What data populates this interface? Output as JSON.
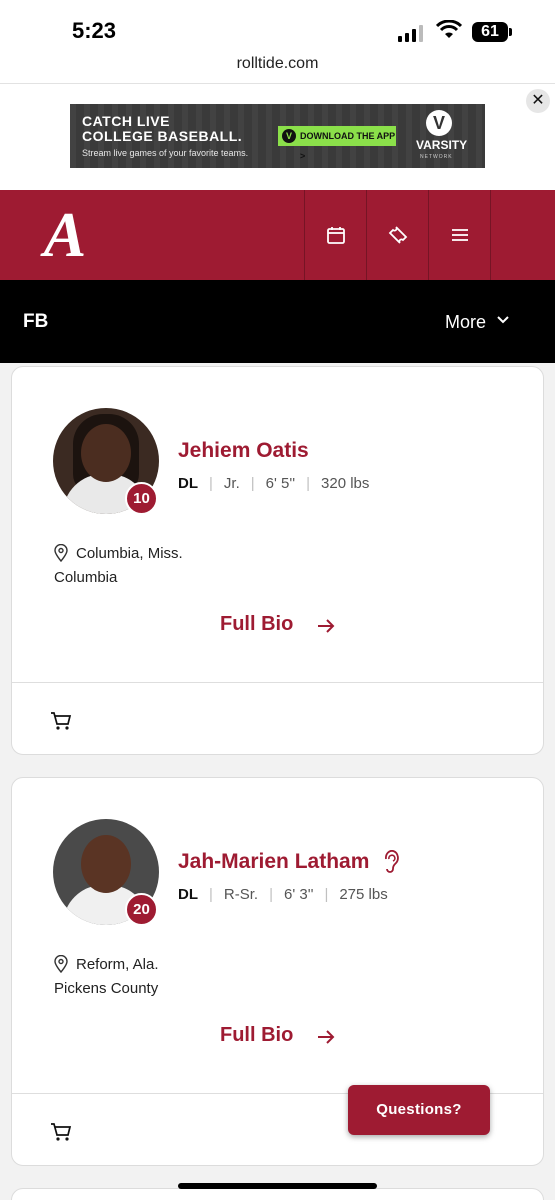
{
  "status_bar": {
    "time": "5:23",
    "battery": "61"
  },
  "browser": {
    "url": "rolltide.com"
  },
  "ad": {
    "line1": "CATCH LIVE",
    "line2": "COLLEGE BASEBALL.",
    "line3": "Stream live games of your favorite teams.",
    "cta": "DOWNLOAD THE APP >",
    "brand_mark": "V",
    "brand": "VARSITY",
    "brand_sub": "NETWORK"
  },
  "header": {
    "logo_letter": "A",
    "icons": [
      "calendar-icon",
      "ticket-icon",
      "menu-icon"
    ]
  },
  "sport_bar": {
    "name": "FB",
    "more": "More"
  },
  "players": [
    {
      "number": "10",
      "name": "Jehiem Oatis",
      "position": "DL",
      "year": "Jr.",
      "height": "6' 5''",
      "weight": "320 lbs",
      "hometown": "Columbia, Miss.",
      "school": "Columbia",
      "bio_link": "Full Bio"
    },
    {
      "number": "20",
      "name": "Jah-Marien Latham",
      "position": "DL",
      "year": "R-Sr.",
      "height": "6' 3''",
      "weight": "275 lbs",
      "hometown": "Reform, Ala.",
      "school": "Pickens County",
      "bio_link": "Full Bio"
    }
  ],
  "questions_button": "Questions?",
  "colors": {
    "crimson": "#9e1b32",
    "black": "#000000"
  }
}
